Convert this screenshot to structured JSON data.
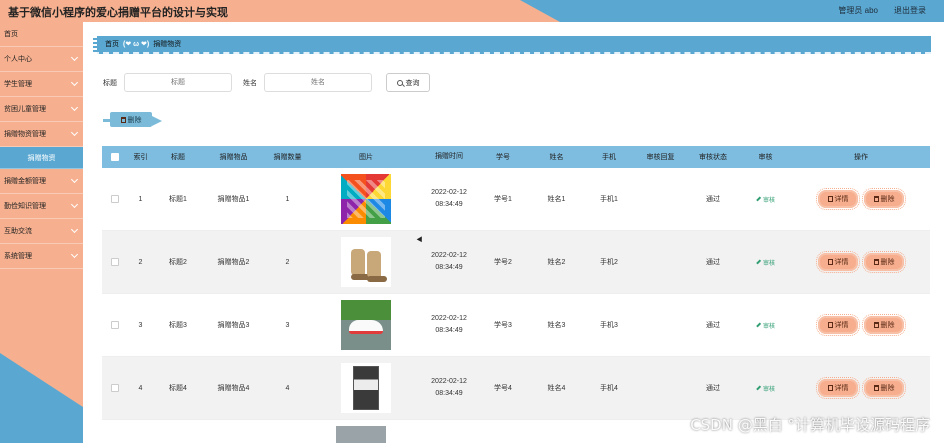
{
  "header": {
    "app_title": "基于微信小程序的爱心捐赠平台的设计与实现",
    "user_label": "管理员 abo",
    "logout_label": "退出登录"
  },
  "sidebar": {
    "items": [
      {
        "label": "首页",
        "has_children": false
      },
      {
        "label": "个人中心",
        "has_children": true
      },
      {
        "label": "学生管理",
        "has_children": true
      },
      {
        "label": "贫困儿童管理",
        "has_children": true
      },
      {
        "label": "捐赠物资管理",
        "has_children": true
      },
      {
        "label": "捐赠物资",
        "sub": true
      },
      {
        "label": "捐赠金额管理",
        "has_children": true
      },
      {
        "label": "勤俭知识管理",
        "has_children": true
      },
      {
        "label": "互助交流",
        "has_children": true
      },
      {
        "label": "系统管理",
        "has_children": true
      }
    ]
  },
  "breadcrumb": {
    "home": "首页",
    "emote": "(❤ ω ❤)",
    "current": "捐赠物资"
  },
  "search": {
    "title_label": "标题",
    "title_placeholder": "标题",
    "name_label": "姓名",
    "name_placeholder": "姓名",
    "button_label": "查询"
  },
  "toolbar": {
    "delete_label": "删除"
  },
  "table": {
    "headers": {
      "index": "索引",
      "title": "标题",
      "item": "捐赠物品",
      "qty": "捐赠数量",
      "image": "图片",
      "time": "捐赠时间",
      "student_id": "学号",
      "name": "姓名",
      "phone": "手机",
      "reply": "审核回复",
      "status": "审核状态",
      "audit": "审核",
      "ops": "操作"
    },
    "rows": [
      {
        "index": "1",
        "title": "标题1",
        "item": "捐赠物品1",
        "qty": "1",
        "date": "2022-02-12",
        "clock": "08:34:49",
        "student_id": "学号1",
        "name": "姓名1",
        "phone": "手机1",
        "reply": "",
        "status": "通过",
        "audit": "审核",
        "detail": "详情",
        "delete": "删除"
      },
      {
        "index": "2",
        "title": "标题2",
        "item": "捐赠物品2",
        "qty": "2",
        "date": "2022-02-12",
        "clock": "08:34:49",
        "student_id": "学号2",
        "name": "姓名2",
        "phone": "手机2",
        "reply": "",
        "status": "通过",
        "audit": "审核",
        "detail": "详情",
        "delete": "删除"
      },
      {
        "index": "3",
        "title": "标题3",
        "item": "捐赠物品3",
        "qty": "3",
        "date": "2022-02-12",
        "clock": "08:34:49",
        "student_id": "学号3",
        "name": "姓名3",
        "phone": "手机3",
        "reply": "",
        "status": "通过",
        "audit": "审核",
        "detail": "详情",
        "delete": "删除"
      },
      {
        "index": "4",
        "title": "标题4",
        "item": "捐赠物品4",
        "qty": "4",
        "date": "2022-02-12",
        "clock": "08:34:49",
        "student_id": "学号4",
        "name": "姓名4",
        "phone": "手机4",
        "reply": "",
        "status": "通过",
        "audit": "审核",
        "detail": "详情",
        "delete": "删除"
      }
    ]
  },
  "watermark": "CSDN @黑白 °计算机毕设源码程序",
  "colors": {
    "accent_blue": "#5aa8d2",
    "accent_peach": "#f6b08f",
    "table_header": "#7ebde0"
  }
}
